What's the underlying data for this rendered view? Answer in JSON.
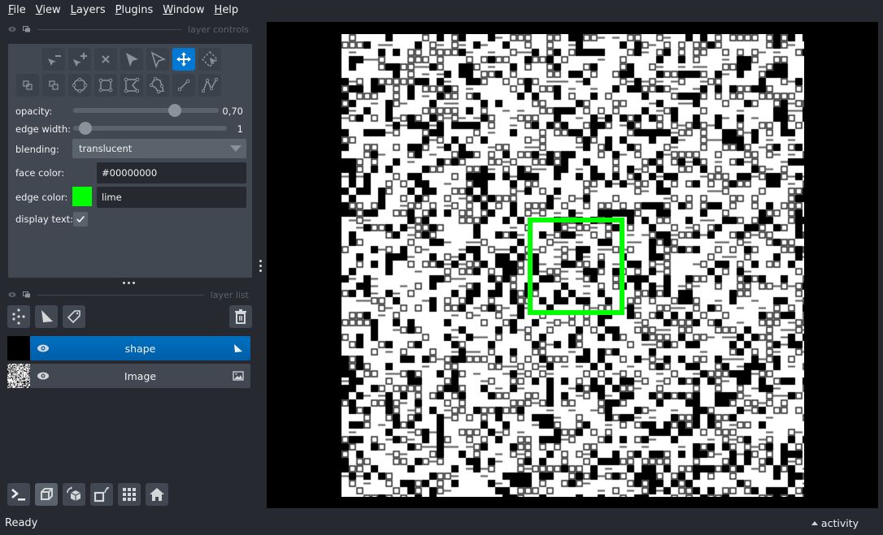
{
  "menubar": {
    "items": [
      {
        "label": "File",
        "mnemonic": "F",
        "rest": "ile"
      },
      {
        "label": "View",
        "mnemonic": "V",
        "rest": "iew"
      },
      {
        "label": "Layers",
        "mnemonic": "L",
        "rest": "ayers"
      },
      {
        "label": "Plugins",
        "mnemonic": "P",
        "rest": "lugins"
      },
      {
        "label": "Window",
        "mnemonic": "W",
        "rest": "indow"
      },
      {
        "label": "Help",
        "mnemonic": "H",
        "rest": "elp"
      }
    ]
  },
  "layer_controls": {
    "title": "layer controls",
    "toolbar_row1": [
      "remove-points-icon",
      "add-points-icon",
      "delete-shape-icon",
      "select-shapes-icon",
      "select-vertices-icon",
      "pan-zoom-icon",
      "transform-icon"
    ],
    "toolbar_row2": [
      "move-back-icon",
      "move-front-icon",
      "ellipse-icon",
      "rectangle-icon",
      "polygon-icon",
      "lasso-icon",
      "line-icon",
      "path-icon"
    ],
    "active_tool": "pan-zoom-icon",
    "opacity": {
      "label": "opacity:",
      "value": 0.7,
      "display": "0,70"
    },
    "edge_width": {
      "label": "edge width:",
      "value": 1,
      "min": 0,
      "max": 40,
      "display": "1"
    },
    "blending": {
      "label": "blending:",
      "value": "translucent"
    },
    "face_color": {
      "label": "face color:",
      "value": "#00000000"
    },
    "edge_color": {
      "label": "edge color:",
      "value": "lime",
      "swatch": "#00ff00"
    },
    "display_text": {
      "label": "display text:",
      "checked": true
    }
  },
  "layer_list": {
    "title": "layer list",
    "buttons": [
      "new-points-layer",
      "new-shapes-layer",
      "new-labels-layer",
      "delete-layer"
    ],
    "layers": [
      {
        "name": "shape",
        "type": "shapes",
        "visible": true,
        "selected": true
      },
      {
        "name": "Image",
        "type": "image",
        "visible": true,
        "selected": false
      }
    ]
  },
  "bottom_buttons": [
    "console",
    "ndisplay-3d",
    "roll-dims",
    "transpose-dims",
    "grid-mode",
    "reset-view"
  ],
  "status": {
    "text": "Ready",
    "activity_label": "activity"
  },
  "colors": {
    "accent": "#0078d4",
    "shape_edge": "#00ff00"
  }
}
